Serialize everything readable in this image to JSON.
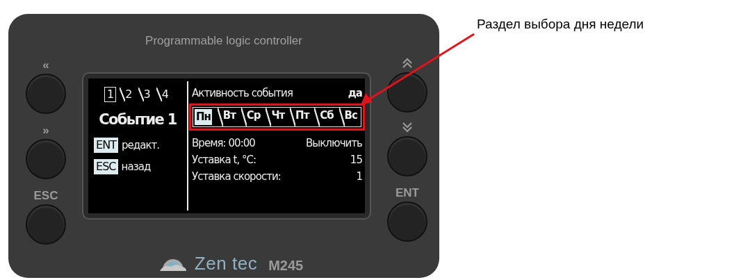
{
  "device": {
    "caption": "Programmable logic controller",
    "left_buttons": [
      {
        "kind": "text",
        "label": "«"
      },
      {
        "kind": "text",
        "label": "»"
      },
      {
        "kind": "text",
        "label": "ESC"
      }
    ],
    "right_buttons": [
      {
        "kind": "up"
      },
      {
        "kind": "down"
      },
      {
        "kind": "text",
        "label": "ENT"
      }
    ],
    "screen": {
      "events": [
        {
          "label": "1",
          "selected": true,
          "active": true
        },
        {
          "label": "2",
          "selected": false,
          "active": false
        },
        {
          "label": "3",
          "selected": false,
          "active": false
        },
        {
          "label": "4",
          "selected": false,
          "active": false
        }
      ],
      "title": "Событие 1",
      "hints": [
        {
          "key": "ENT",
          "text": "редакт."
        },
        {
          "key": "ESC",
          "text": "назад"
        }
      ],
      "activity": {
        "label": "Активность события",
        "value": "да"
      },
      "days": [
        {
          "label": "Пн",
          "selected": true,
          "active": true
        },
        {
          "label": "Вт",
          "selected": false,
          "active": false
        },
        {
          "label": "Ср",
          "selected": false,
          "active": false
        },
        {
          "label": "Чт",
          "selected": false,
          "active": false
        },
        {
          "label": "Пт",
          "selected": false,
          "active": false
        },
        {
          "label": "Сб",
          "selected": false,
          "active": false
        },
        {
          "label": "Вс",
          "selected": false,
          "active": false
        }
      ],
      "rows": [
        {
          "label": "Время: 00:00",
          "value": "Выключить"
        },
        {
          "label": "Уставка t, °C:",
          "value": "15"
        },
        {
          "label": "Уставка скорости:",
          "value": "1"
        }
      ]
    },
    "brand": {
      "name": "Zen tec",
      "model": "M245"
    }
  },
  "annotation": {
    "text": "Раздел выбора дня недели"
  }
}
